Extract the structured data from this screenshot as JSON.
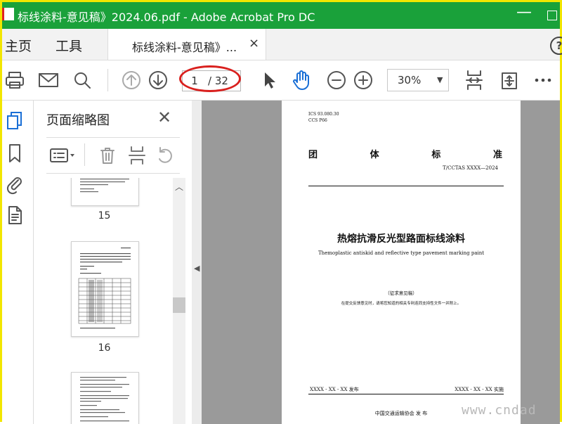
{
  "window": {
    "title": "标线涂料-意见稿》2024.06.pdf - Adobe Acrobat Pro DC",
    "controls": [
      "minimize-icon",
      "maximize-icon"
    ]
  },
  "tabs": {
    "home": "主页",
    "tools": "工具",
    "document": "标线涂料-意见稿》...",
    "close": "×"
  },
  "toolbar": {
    "icons": [
      "print-icon",
      "email-icon",
      "search-icon",
      "arrow-up-icon",
      "arrow-down-icon",
      "select-pointer-icon",
      "hand-icon",
      "zoom-out-icon",
      "zoom-in-icon",
      "fit-page-icon",
      "rotate-icon",
      "more-icon"
    ],
    "page": {
      "current": "1",
      "total": "/ 32"
    },
    "zoom": "30%"
  },
  "rail": {
    "icons": [
      "pages-icon",
      "bookmark-icon",
      "attachment-icon",
      "document-icon"
    ]
  },
  "panel": {
    "title": "页面缩略图",
    "close": "✕",
    "tools": [
      "options-icon",
      "delete-icon",
      "extract-icon",
      "undo-icon"
    ],
    "thumbnails": [
      {
        "label": "15"
      },
      {
        "label": "16"
      },
      {
        "label": ""
      }
    ]
  },
  "doc": {
    "ics": "ICS  93.080.30",
    "ccs": "CCS  P66",
    "org": [
      "团",
      "体",
      "标",
      "准"
    ],
    "number": "T/CCTAS  XXXX—2024",
    "title_cn": "热熔抗滑反光型路面标线涂料",
    "title_en": "Themoplastic antiskid and reflective type pavement marking paint",
    "status": "（征求意见稿）",
    "note": "在提交反馈意见时，请将您知道的相关专利连同支持性文件一并附上。",
    "issue": "XXXX - XX - XX 发布",
    "implement": "XXXX - XX - XX 实施",
    "publisher": "中国交通运输协会      发  布"
  },
  "watermark": "www.cndad"
}
